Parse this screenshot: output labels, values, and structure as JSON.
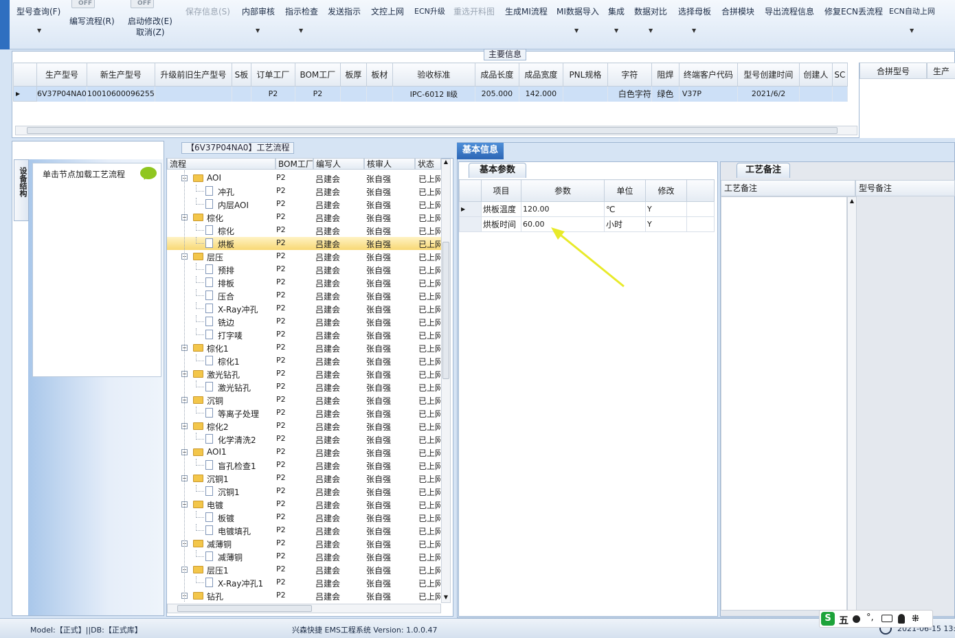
{
  "toolbar": {
    "items": [
      {
        "label": "型号查询(F)",
        "disabled": false
      },
      {
        "label": "编写流程(R)",
        "disabled": false
      },
      {
        "label": "启动修改(E)",
        "disabled": false
      },
      {
        "label": "取消(Z)",
        "disabled": false
      },
      {
        "label": "保存信息(S)",
        "disabled": true
      },
      {
        "label": "内部审核",
        "disabled": false
      },
      {
        "label": "指示检查",
        "disabled": false
      },
      {
        "label": "发送指示",
        "disabled": false
      },
      {
        "label": "文控上网",
        "disabled": false
      },
      {
        "label": "ECN升级",
        "disabled": false
      },
      {
        "label": "重选开料图",
        "disabled": true
      },
      {
        "label": "生成MI流程",
        "disabled": false
      },
      {
        "label": "MI数据导入",
        "disabled": false
      },
      {
        "label": "集成",
        "disabled": false
      },
      {
        "label": "数据对比",
        "disabled": false
      },
      {
        "label": "选择母板",
        "disabled": false
      },
      {
        "label": "合拼模块",
        "disabled": false
      },
      {
        "label": "导出流程信息",
        "disabled": false
      },
      {
        "label": "修复ECN丢流程",
        "disabled": false
      },
      {
        "label": "ECN自动上网",
        "disabled": false
      }
    ],
    "toggle_off": "OFF"
  },
  "main_info": {
    "title": "主要信息",
    "columns": [
      "生产型号",
      "新生产型号",
      "升级前旧生产型号",
      "S板",
      "订单工厂",
      "BOM工厂",
      "板厚",
      "板材",
      "验收标准",
      "成品长度",
      "成品宽度",
      "PNL规格",
      "字符",
      "阻焊",
      "终端客户代码",
      "型号创建时间",
      "创建人",
      "SC"
    ],
    "row": [
      "6V37P04NA0",
      "10010600096255",
      "",
      "",
      "P2",
      "P2",
      "",
      "",
      "IPC-6012 Ⅱ级",
      "205.000",
      "142.000",
      "",
      "白色字符",
      "绿色",
      "V37P",
      "2021/6/2",
      "",
      ""
    ],
    "side_columns": [
      "合拼型号",
      "生产"
    ]
  },
  "left_panel": {
    "vertical_tab": "设备结构",
    "load_label": "单击节点加载工艺流程"
  },
  "tree": {
    "title": "【6V37P04NA0】工艺流程",
    "columns": [
      "流程",
      "BOM工厂",
      "编写人",
      "核审人",
      "状态"
    ],
    "rows": [
      {
        "name": "AOI",
        "level": 0,
        "bom": "P2",
        "writer": "吕建会",
        "reviewer": "张自强",
        "status": "已上网"
      },
      {
        "name": "冲孔",
        "level": 1,
        "bom": "P2",
        "writer": "吕建会",
        "reviewer": "张自强",
        "status": "已上网"
      },
      {
        "name": "内层AOI",
        "level": 1,
        "bom": "P2",
        "writer": "吕建会",
        "reviewer": "张自强",
        "status": "已上网"
      },
      {
        "name": "棕化",
        "level": 0,
        "bom": "P2",
        "writer": "吕建会",
        "reviewer": "张自强",
        "status": "已上网"
      },
      {
        "name": "棕化",
        "level": 1,
        "bom": "P2",
        "writer": "吕建会",
        "reviewer": "张自强",
        "status": "已上网"
      },
      {
        "name": "烘板",
        "level": 1,
        "bom": "P2",
        "writer": "吕建会",
        "reviewer": "张自强",
        "status": "已上网",
        "selected": true
      },
      {
        "name": "层压",
        "level": 0,
        "bom": "P2",
        "writer": "吕建会",
        "reviewer": "张自强",
        "status": "已上网"
      },
      {
        "name": "预排",
        "level": 1,
        "bom": "P2",
        "writer": "吕建会",
        "reviewer": "张自强",
        "status": "已上网"
      },
      {
        "name": "排板",
        "level": 1,
        "bom": "P2",
        "writer": "吕建会",
        "reviewer": "张自强",
        "status": "已上网"
      },
      {
        "name": "压合",
        "level": 1,
        "bom": "P2",
        "writer": "吕建会",
        "reviewer": "张自强",
        "status": "已上网"
      },
      {
        "name": "X-Ray冲孔",
        "level": 1,
        "bom": "P2",
        "writer": "吕建会",
        "reviewer": "张自强",
        "status": "已上网"
      },
      {
        "name": "铣边",
        "level": 1,
        "bom": "P2",
        "writer": "吕建会",
        "reviewer": "张自强",
        "status": "已上网"
      },
      {
        "name": "打字唛",
        "level": 1,
        "bom": "P2",
        "writer": "吕建会",
        "reviewer": "张自强",
        "status": "已上网"
      },
      {
        "name": "棕化1",
        "level": 0,
        "bom": "P2",
        "writer": "吕建会",
        "reviewer": "张自强",
        "status": "已上网"
      },
      {
        "name": "棕化1",
        "level": 1,
        "bom": "P2",
        "writer": "吕建会",
        "reviewer": "张自强",
        "status": "已上网"
      },
      {
        "name": "激光钻孔",
        "level": 0,
        "bom": "P2",
        "writer": "吕建会",
        "reviewer": "张自强",
        "status": "已上网"
      },
      {
        "name": "激光钻孔",
        "level": 1,
        "bom": "P2",
        "writer": "吕建会",
        "reviewer": "张自强",
        "status": "已上网"
      },
      {
        "name": "沉铜",
        "level": 0,
        "bom": "P2",
        "writer": "吕建会",
        "reviewer": "张自强",
        "status": "已上网"
      },
      {
        "name": "等离子处理",
        "level": 1,
        "bom": "P2",
        "writer": "吕建会",
        "reviewer": "张自强",
        "status": "已上网"
      },
      {
        "name": "棕化2",
        "level": 0,
        "bom": "P2",
        "writer": "吕建会",
        "reviewer": "张自强",
        "status": "已上网"
      },
      {
        "name": "化学清洗2",
        "level": 1,
        "bom": "P2",
        "writer": "吕建会",
        "reviewer": "张自强",
        "status": "已上网"
      },
      {
        "name": "AOI1",
        "level": 0,
        "bom": "P2",
        "writer": "吕建会",
        "reviewer": "张自强",
        "status": "已上网"
      },
      {
        "name": "盲孔检查1",
        "level": 1,
        "bom": "P2",
        "writer": "吕建会",
        "reviewer": "张自强",
        "status": "已上网"
      },
      {
        "name": "沉铜1",
        "level": 0,
        "bom": "P2",
        "writer": "吕建会",
        "reviewer": "张自强",
        "status": "已上网"
      },
      {
        "name": "沉铜1",
        "level": 1,
        "bom": "P2",
        "writer": "吕建会",
        "reviewer": "张自强",
        "status": "已上网"
      },
      {
        "name": "电镀",
        "level": 0,
        "bom": "P2",
        "writer": "吕建会",
        "reviewer": "张自强",
        "status": "已上网"
      },
      {
        "name": "板镀",
        "level": 1,
        "bom": "P2",
        "writer": "吕建会",
        "reviewer": "张自强",
        "status": "已上网"
      },
      {
        "name": "电镀填孔",
        "level": 1,
        "bom": "P2",
        "writer": "吕建会",
        "reviewer": "张自强",
        "status": "已上网"
      },
      {
        "name": "减薄铜",
        "level": 0,
        "bom": "P2",
        "writer": "吕建会",
        "reviewer": "张自强",
        "status": "已上网"
      },
      {
        "name": "减薄铜",
        "level": 1,
        "bom": "P2",
        "writer": "吕建会",
        "reviewer": "张自强",
        "status": "已上网"
      },
      {
        "name": "层压1",
        "level": 0,
        "bom": "P2",
        "writer": "吕建会",
        "reviewer": "张自强",
        "status": "已上网"
      },
      {
        "name": "X-Ray冲孔1",
        "level": 1,
        "bom": "P2",
        "writer": "吕建会",
        "reviewer": "张自强",
        "status": "已上网"
      },
      {
        "name": "钻孔",
        "level": 0,
        "bom": "P2",
        "writer": "吕建会",
        "reviewer": "张自强",
        "status": "已上网"
      }
    ]
  },
  "basic_info": {
    "tab": "基本信息",
    "params_tab": "基本参数",
    "param_columns": [
      "项目",
      "参数",
      "单位",
      "修改"
    ],
    "params": [
      {
        "item": "烘板温度",
        "value": "120.00",
        "unit": "℃",
        "modify": "Y"
      },
      {
        "item": "烘板时间",
        "value": "60.00",
        "unit": "小时",
        "modify": "Y"
      }
    ],
    "notes_tab": "工艺备注",
    "note_columns": [
      "工艺备注",
      "型号备注"
    ]
  },
  "status_bar": {
    "model": "Model:【正式】||DB:【正式库】",
    "app": "兴森快捷 EMS工程系统 Version: 1.0.0.47",
    "date": "2021-06-15 13:"
  },
  "ime": {
    "label": "五"
  },
  "colors": {
    "selection": "#cde0f7",
    "tree_selected": "#f8d874",
    "tab_active": "#2c66b5",
    "arrow": "#e8ea2a"
  }
}
